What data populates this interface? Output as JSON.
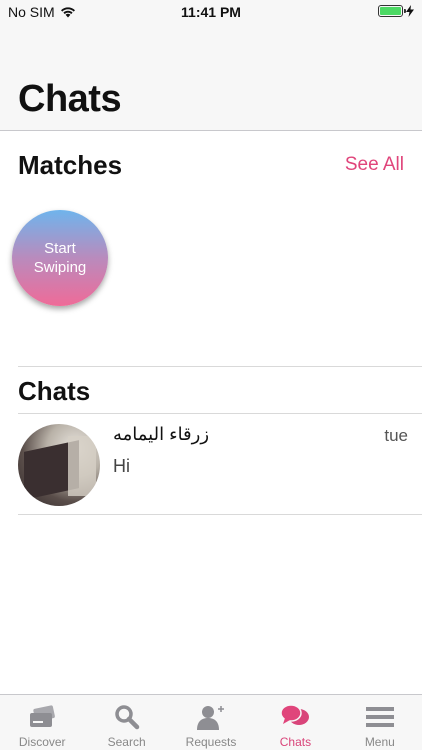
{
  "status": {
    "carrier": "No SIM",
    "time": "11:41 PM",
    "battery_level": 1.0
  },
  "header": {
    "title": "Chats"
  },
  "matches": {
    "title": "Matches",
    "see_all": "See All",
    "swipe_label": "Start\nSwiping"
  },
  "chats": {
    "title": "Chats",
    "items": [
      {
        "name": "زرقاء اليمامه",
        "time": "tue",
        "message": "Hi"
      }
    ]
  },
  "colors": {
    "accent": "#e0457b",
    "tab_active": "#d9457a",
    "tab_inactive": "#8e8e93"
  },
  "tabbar": {
    "active": "chats",
    "items": [
      {
        "key": "discover",
        "label": "Discover",
        "icon": "cards-icon"
      },
      {
        "key": "search",
        "label": "Search",
        "icon": "search-icon"
      },
      {
        "key": "requests",
        "label": "Requests",
        "icon": "add-user-icon"
      },
      {
        "key": "chats",
        "label": "Chats",
        "icon": "chat-bubbles-icon"
      },
      {
        "key": "menu",
        "label": "Menu",
        "icon": "menu-icon"
      }
    ]
  }
}
